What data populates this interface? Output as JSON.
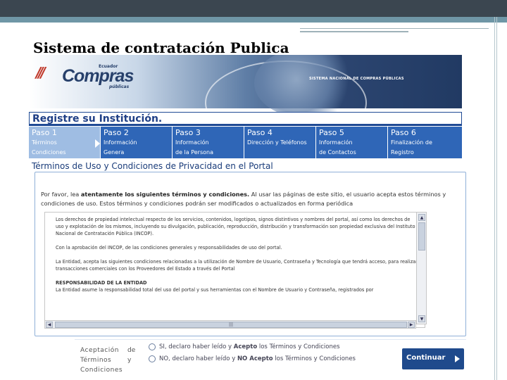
{
  "slide": {
    "title": "Sistema de contratación Publica"
  },
  "banner": {
    "logo_country": "Ecuador",
    "logo_name": "Compras",
    "logo_sub": "públicas",
    "system_name": "SISTEMA NACIONAL DE COMPRAS PÚBLICAS"
  },
  "registration": {
    "title": "Registre su Institución.",
    "steps": [
      {
        "num": "Paso 1",
        "desc": "Términos\nCondiciones"
      },
      {
        "num": "Paso 2",
        "desc": "Información\nGenera"
      },
      {
        "num": "Paso 3",
        "desc": "Información\nde la Persona"
      },
      {
        "num": "Paso 4",
        "desc": "Dirección y Teléfonos"
      },
      {
        "num": "Paso 5",
        "desc": "Información\nde Contactos"
      },
      {
        "num": "Paso 6",
        "desc": "Finalización de\nRegistro"
      }
    ]
  },
  "terms": {
    "heading": "Términos de Uso y Condiciones de Privacidad en el Portal",
    "intro_prefix": "Por favor, lea ",
    "intro_bold": "atentamente los siguientes términos y condiciones.",
    "intro_rest": " Al usar las páginas de este sitio, el usuario acepta estos términos y condiciones de uso. Estos términos y condiciones podrán ser modificados o actualizados en forma periódica",
    "paragraph_1": "Los derechos de propiedad intelectual respecto de los servicios, contenidos, logotipos, signos distintivos y nombres del portal, así como los derechos de uso y explotación de los mismos, incluyendo su divulgación, publicación, reproducción, distribución y transformación son propiedad exclusiva del Instituto Nacional de Contratación Pública (INCOP).",
    "paragraph_2": "Con la aprobación del INCOP, de las condiciones generales y responsabilidades de uso del portal.",
    "paragraph_3": "La Entidad, acepta las siguientes condiciones relacionadas a la utilización de Nombre de Usuario, Contraseña y Tecnología que tendrá acceso, para realizar transacciones comerciales con los Proveedores del Estado a través del Portal",
    "section_title": "RESPONSABILIDAD DE LA ENTIDAD",
    "paragraph_4": "La Entidad asume la responsabilidad total del uso del portal y sus herramientas con el Nombre de Usuario y Contraseña, registrados por"
  },
  "acceptance": {
    "label": "Aceptación\nTérminos\nCondiciones",
    "colon": "de\ny",
    "option_yes_prefix": "SI, declaro haber leído y ",
    "option_yes_bold": "Acepto",
    "option_yes_rest": " los Términos y Condiciones",
    "option_no_prefix": "NO, declaro haber leído y ",
    "option_no_bold": "NO Acepto",
    "option_no_rest": " los Términos y Condiciones",
    "continue_label": "Continuar"
  },
  "colors": {
    "step_blue": "#2f66b7",
    "step_active": "#9fbde3",
    "header_blue": "#1f3f86",
    "button_blue": "#1f4a8c"
  }
}
